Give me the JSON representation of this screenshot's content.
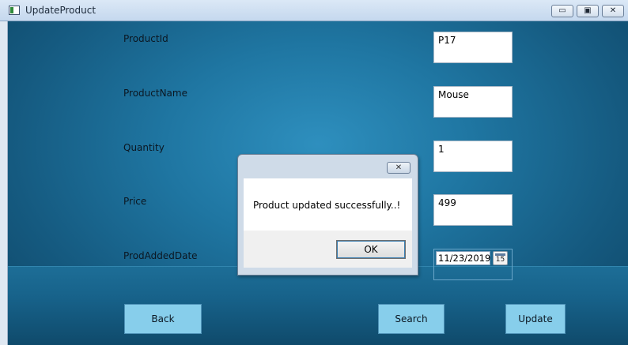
{
  "window": {
    "title": "UpdateProduct",
    "controls": {
      "minimize": "▭",
      "maximize": "▣",
      "close": "✕"
    }
  },
  "form": {
    "fields": [
      {
        "label": "ProductId",
        "value": "P17"
      },
      {
        "label": "ProductName",
        "value": "Mouse"
      },
      {
        "label": "Quantity",
        "value": "1"
      },
      {
        "label": "Price",
        "value": "499"
      }
    ],
    "date": {
      "label": "ProdAddedDate",
      "value": "11/23/2019",
      "calendar_day": "15"
    }
  },
  "buttons": {
    "back": "Back",
    "search": "Search",
    "update": "Update"
  },
  "dialog": {
    "message": "Product updated successfully..!",
    "ok": "OK",
    "close": "✕"
  },
  "colors": {
    "background": "#1f76a2",
    "button": "#87ceeb",
    "titlebar": "#dbe8f6"
  },
  "icons": {
    "app": "window-app-icon",
    "calendar": "calendar-icon"
  }
}
